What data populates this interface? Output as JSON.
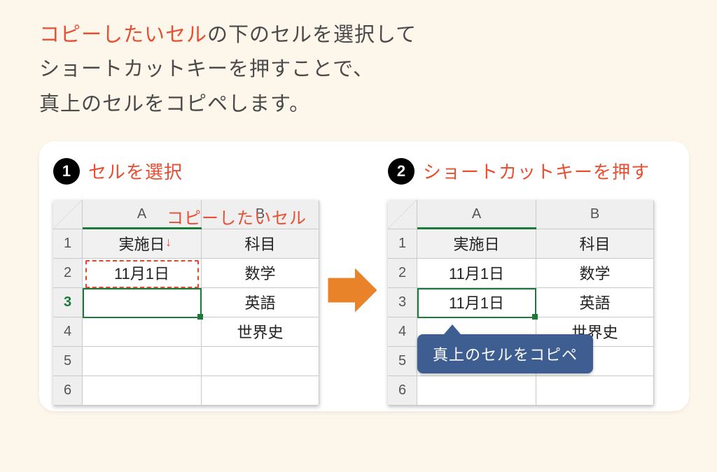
{
  "colors": {
    "accent_red": "#e84e32",
    "excel_green": "#1b7a3a",
    "arrow_orange": "#e8832a",
    "tooltip_blue": "#3e5e91"
  },
  "instruction": {
    "highlight": "コピーしたいセル",
    "line1_rest": "の下のセルを選択して",
    "line2": "ショートカットキーを押すことで、",
    "line3": "真上のセルをコピペします。"
  },
  "steps": {
    "one": {
      "num": "1",
      "label": "セルを選択"
    },
    "two": {
      "num": "2",
      "label": "ショートカットキーを押す"
    }
  },
  "columns": [
    "A",
    "B"
  ],
  "row_headers": [
    "1",
    "2",
    "3",
    "4",
    "5",
    "6"
  ],
  "table_left": {
    "rows": [
      {
        "a": "実施日",
        "b": "科目"
      },
      {
        "a": "11月1日",
        "b": "数学"
      },
      {
        "a": "",
        "b": "英語"
      },
      {
        "a": "",
        "b": "世界史"
      },
      {
        "a": "",
        "b": ""
      },
      {
        "a": "",
        "b": ""
      }
    ],
    "annotation_copy_cell": "コピーしたいセル",
    "down_arrow": "↓",
    "active_row": 3
  },
  "table_right": {
    "rows": [
      {
        "a": "実施日",
        "b": "科目"
      },
      {
        "a": "11月1日",
        "b": "数学"
      },
      {
        "a": "11月1日",
        "b": "英語"
      },
      {
        "a": "",
        "b": "世界史"
      },
      {
        "a": "",
        "b": ""
      },
      {
        "a": "",
        "b": ""
      }
    ],
    "tooltip": "真上のセルをコピペ"
  }
}
